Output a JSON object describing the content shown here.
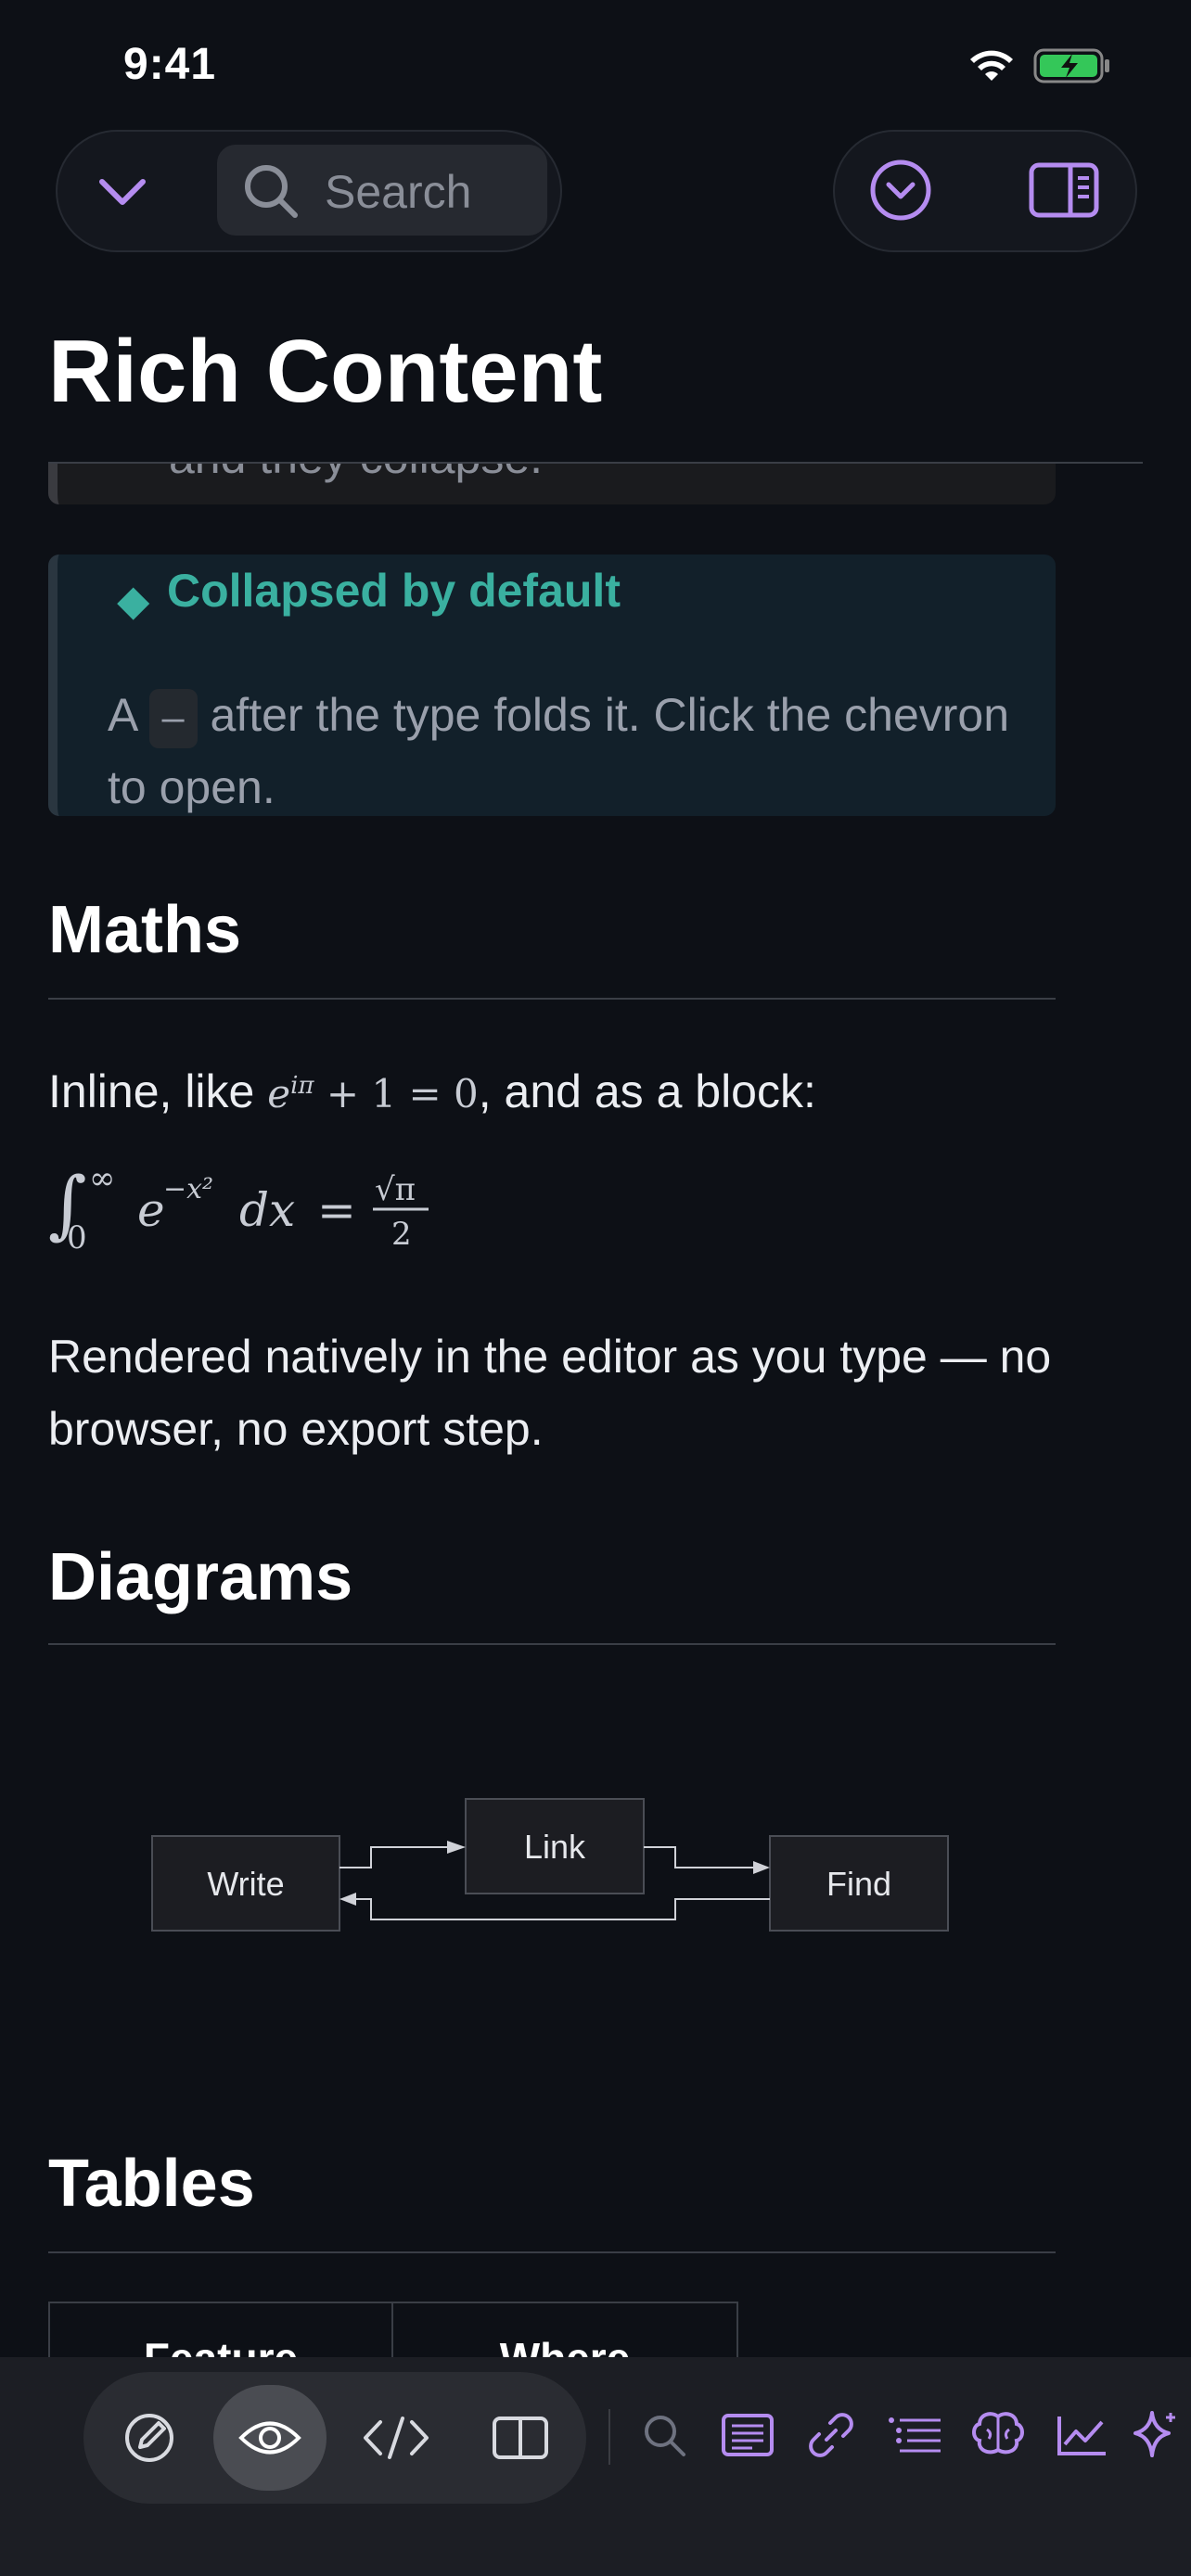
{
  "status_bar": {
    "time": "9:41"
  },
  "toolbar": {
    "search_placeholder": "Search"
  },
  "page": {
    "title": "Rich Content"
  },
  "partial_callout": {
    "text": "and they collapse."
  },
  "callout": {
    "title": "Collapsed by default",
    "body_before": "A",
    "code": "–",
    "body_after": "after the type folds it. Click the chevron to open."
  },
  "maths": {
    "heading": "Maths",
    "inline_prefix": "Inline, like",
    "inline_suffix": ", and as a block:",
    "after": "Rendered natively in the editor as you type — no browser, no export step."
  },
  "diagrams": {
    "heading": "Diagrams",
    "nodes": [
      "Write",
      "Link",
      "Find"
    ]
  },
  "tables": {
    "heading": "Tables",
    "columns": [
      "Feature",
      "Where"
    ]
  },
  "colors": {
    "accent": "#b58cf0",
    "callout": "#3ab0a0",
    "background": "#0d1016"
  }
}
